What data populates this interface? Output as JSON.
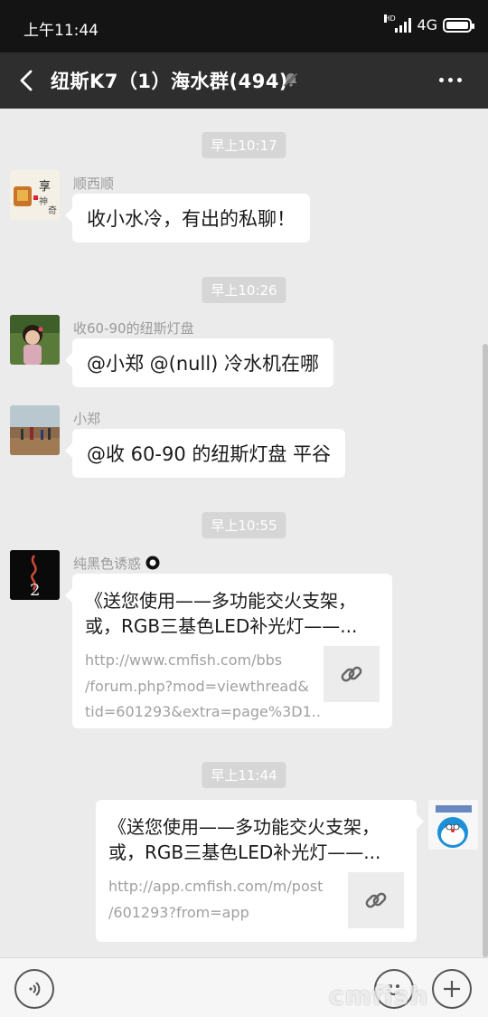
{
  "status_bar": {
    "time": "上午11:44",
    "hd": "HD",
    "network": "4G"
  },
  "header": {
    "title": "纽斯K7（1）海水群(494)",
    "back_icon": "back-arrow-icon",
    "mute_icon": "bell-off-icon",
    "more_icon": "more-dots-icon"
  },
  "messages": [
    {
      "type": "time",
      "text": "早上10:17"
    },
    {
      "type": "text",
      "side": "left",
      "sender": "顺西顺",
      "text": "收小水冷，有出的私聊！"
    },
    {
      "type": "time",
      "text": "早上10:26"
    },
    {
      "type": "text",
      "side": "left",
      "sender": "收60-90的纽斯灯盘",
      "text": "@小郑  @(null)  冷水机在哪"
    },
    {
      "type": "text",
      "side": "left",
      "sender": "小郑",
      "text": "@收 60-90 的纽斯灯盘  平谷"
    },
    {
      "type": "time",
      "text": "早上10:55"
    },
    {
      "type": "link",
      "side": "left",
      "sender": "纯黑色诱惑",
      "title_lines": [
        "《送您使用——多功能交火支架，",
        "或，RGB三基色LED补光灯——..."
      ],
      "url_lines": [
        "http://www.cmfish.com/bbs",
        "/forum.php?mod=viewthread&",
        "tid=601293&extra=page%3D1..."
      ],
      "thumb_icon": "link-icon"
    },
    {
      "type": "time",
      "text": "早上11:44"
    },
    {
      "type": "link",
      "side": "right",
      "title_lines": [
        "《送您使用——多功能交火支架，",
        "或，RGB三基色LED补光灯——..."
      ],
      "url_lines": [
        "http://app.cmfish.com/m/post",
        "/601293?from=app"
      ],
      "thumb_icon": "link-icon"
    }
  ],
  "input_bar": {
    "voice_icon": "voice-icon",
    "emoji_icon": "emoji-icon",
    "plus_icon": "plus-icon"
  },
  "watermark": "cmfish"
}
